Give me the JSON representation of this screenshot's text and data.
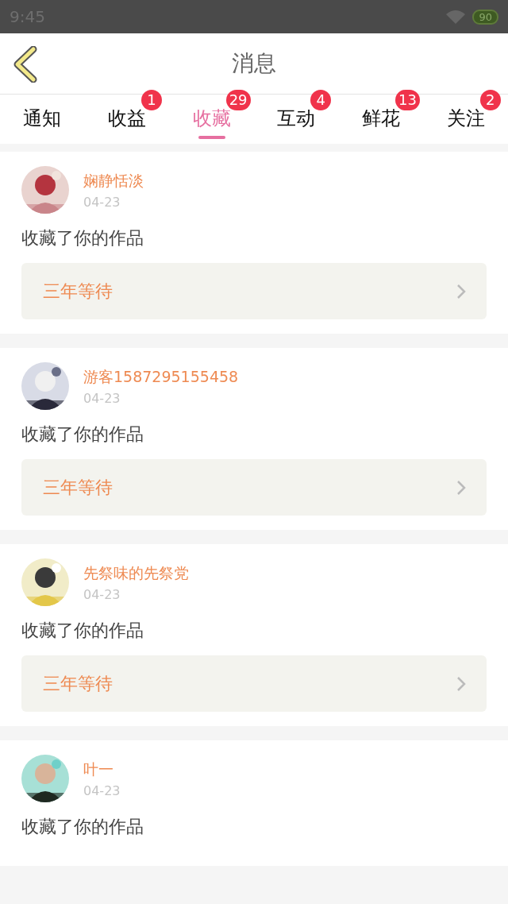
{
  "status_bar": {
    "time": "9:45",
    "battery": "90"
  },
  "header": {
    "title": "消息"
  },
  "tabs": [
    {
      "label": "通知",
      "selected": false
    },
    {
      "label": "收益",
      "badge": "1",
      "selected": false
    },
    {
      "label": "收藏",
      "badge": "29",
      "selected": true
    },
    {
      "label": "互动",
      "badge": "4",
      "selected": false
    },
    {
      "label": "鲜花",
      "badge": "13",
      "selected": false
    },
    {
      "label": "关注",
      "badge": "2",
      "selected": false
    }
  ],
  "messages": [
    {
      "user": "娴静恬淡",
      "date": "04-23",
      "action": "收藏了你的作品",
      "work": "三年等待"
    },
    {
      "user": "游客1587295155458",
      "date": "04-23",
      "action": "收藏了你的作品",
      "work": "三年等待"
    },
    {
      "user": "先祭味的先祭党",
      "date": "04-23",
      "action": "收藏了你的作品",
      "work": "三年等待"
    },
    {
      "user": "叶一",
      "date": "04-23",
      "action": "收藏了你的作品"
    }
  ]
}
